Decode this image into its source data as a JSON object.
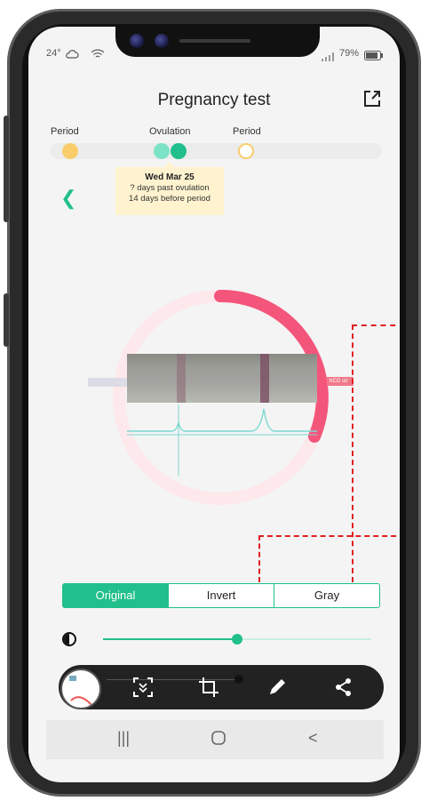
{
  "status_bar": {
    "temperature": "24°",
    "battery": "79%"
  },
  "header": {
    "title": "Pregnancy test",
    "share_icon": "share-icon"
  },
  "cycle": {
    "labels": [
      "Period",
      "Ovulation",
      "Period"
    ],
    "colors": {
      "period": "#f9cd6b",
      "ovulation": "#21bf8b",
      "ovulation_light": "#7de3c6",
      "period_outline": "#f9cd6b"
    }
  },
  "tooltip": {
    "date": "Wed Mar 25",
    "line1": "? days past ovulation",
    "line2": "14 days before period"
  },
  "strip": {
    "tag": "hCG str"
  },
  "segmented": {
    "options": [
      "Original",
      "Invert",
      "Gray"
    ],
    "selected": "Original"
  },
  "slider": {
    "value": 0.5,
    "icon": "contrast-icon"
  },
  "toolbar": {
    "tools": [
      "scan-icon",
      "crop-icon",
      "pencil-icon",
      "share-icon"
    ]
  },
  "navbar": {
    "recent": "|||",
    "home": "O",
    "back": "<"
  },
  "colors": {
    "accent": "#21bf8b",
    "ring": "#f4557a",
    "ring_bg": "#fde8ec"
  }
}
